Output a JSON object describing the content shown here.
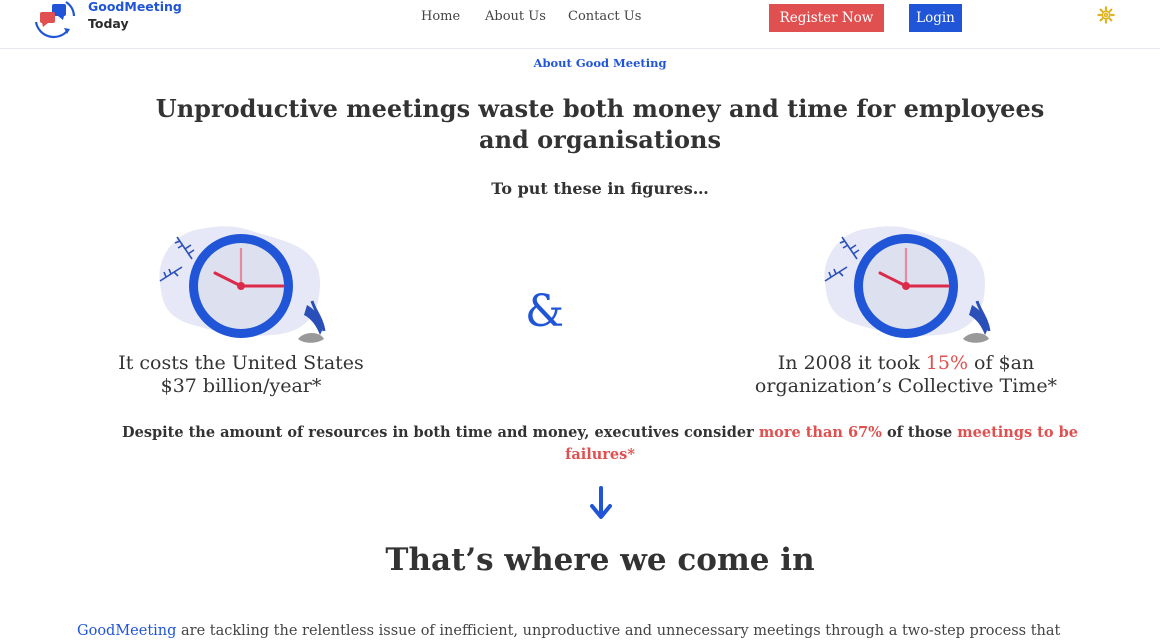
{
  "header": {
    "brand_line1": "GoodMeeting",
    "brand_line2": "Today",
    "nav": [
      {
        "label": "Home"
      },
      {
        "label": "About Us"
      },
      {
        "label": "Contact Us"
      }
    ],
    "register_label": "Register Now",
    "login_label": "Login",
    "settings_icon": "gear-icon"
  },
  "main": {
    "eyebrow": "About Good Meeting",
    "headline": "Unproductive meetings waste both money and time for employees and organisations",
    "subhead": "To put these in figures…",
    "ampersand": "&",
    "stat_left": {
      "line1": "It costs the United States",
      "line2": "$37 billion/year*"
    },
    "stat_right": {
      "pre": "In 2008 it took ",
      "highlight": "15%",
      "post": " of $an",
      "line2": "organization’s Collective Time*"
    },
    "despite": {
      "pre": "Despite the amount of resources in both time and money, executives consider ",
      "highlight1": "more than 67%",
      "mid": " of those ",
      "highlight2": "meetings to be failures*"
    },
    "section_title": "That’s where we come in",
    "intro": {
      "brand": "GoodMeeting",
      "text": " are tackling the relentless issue of inefficient, unproductive and unnecessary meetings through a two-step process that"
    }
  },
  "colors": {
    "accent_blue": "#1f55d6",
    "accent_red": "#e15050",
    "gear_yellow": "#e0b21d",
    "clock_ring": "#1f55d6",
    "clock_face": "#dde0ee",
    "blob": "#e6e8f7"
  }
}
